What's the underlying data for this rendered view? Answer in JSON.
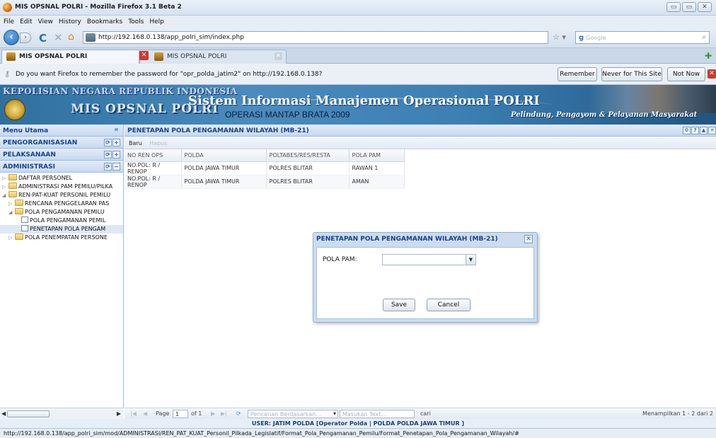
{
  "window": {
    "title": "MIS OPSNAL POLRI - Mozilla Firefox 3.1 Beta 2",
    "buttons": [
      "▭",
      "▭",
      "✕"
    ]
  },
  "menubar": [
    "File",
    "Edit",
    "View",
    "History",
    "Bookmarks",
    "Tools",
    "Help"
  ],
  "nav": {
    "url": "http://192.168.0.138/app_polri_sim/index.php",
    "search_placeholder": "Google"
  },
  "tabs": [
    {
      "label": "MIS OPSNAL POLRI",
      "active": true
    },
    {
      "label": "MIS OPSNAL POLRI",
      "active": false
    }
  ],
  "password_bar": {
    "message": "Do you want Firefox to remember the password for \"opr_polda_jatim2\" on http://192.168.0.138?",
    "remember": "Remember",
    "never": "Never for This Site",
    "not_now": "Not Now"
  },
  "banner": {
    "org": "KEPOLISIAN NEGARA REPUBLIK INDONESIA",
    "app": "MIS OPSNAL POLRI",
    "system": "Sistem Informasi Manajemen Operasional POLRI",
    "operation": "OPERASI MANTAP BRATA 2009",
    "motto": "Pelindung, Pengayom & Pelayanan Masyarakat"
  },
  "left": {
    "menu_title": "Menu Utama",
    "sections": [
      {
        "label": "PENGORGANISASIAN"
      },
      {
        "label": "PELAKSANAAN"
      },
      {
        "label": "ADMINISTRASI"
      }
    ],
    "tree": [
      {
        "label": "DAFTAR PERSONEL",
        "indent": 0,
        "open": false,
        "type": "folder"
      },
      {
        "label": "ADMINISTRASI PAM PEMILU/PILKA",
        "indent": 0,
        "open": false,
        "type": "folder"
      },
      {
        "label": "REN-PAT-KUAT PERSONIL PEMILU",
        "indent": 0,
        "open": true,
        "type": "folder"
      },
      {
        "label": "RENCANA PENGGELARAN PAS",
        "indent": 1,
        "open": false,
        "type": "folder"
      },
      {
        "label": "POLA PENGAMANAN PEMILU",
        "indent": 1,
        "open": true,
        "type": "folder"
      },
      {
        "label": "POLA PENGAMANAN PEMIL",
        "indent": 2,
        "type": "doc"
      },
      {
        "label": "PENETAPAN POLA PENGAM",
        "indent": 2,
        "type": "doc",
        "selected": true
      },
      {
        "label": "POLA PENEMPATAN PERSONE",
        "indent": 1,
        "open": false,
        "type": "folder"
      }
    ]
  },
  "main": {
    "title": "PENETAPAN POLA PENGAMANAN WILAYAH (MB-21)",
    "toolbar": {
      "new": "Baru",
      "delete": "Hapus"
    },
    "columns": [
      "NO REN OPS",
      "POLDA",
      "POLTABES/RES/RESTA",
      "POLA PAM"
    ],
    "rows": [
      [
        "NO.POL: R / RENOP",
        "POLDA JAWA TIMUR",
        "POLRES BLITAR",
        "RAWAN 1"
      ],
      [
        "NO.POL: R / RENOP",
        "POLDA JAWA TIMUR",
        "POLRES BLITAR",
        "AMAN"
      ]
    ],
    "pager": {
      "page_label": "Page",
      "page": "1",
      "of": "of 1",
      "search_by": "Pencarian Berdasarkan...",
      "search_text": "Masukan Text...",
      "search_btn": "cari",
      "display": "Menampilkan 1 - 2 dari 2"
    }
  },
  "dialog": {
    "title": "PENETAPAN POLA PENGAMANAN WILAYAH (MB-21)",
    "field_label": "POLA PAM:",
    "field_value": "",
    "save": "Save",
    "cancel": "Cancel"
  },
  "user_line": "USER: JATIM POLDA [Operator Polda | POLDA POLDA JAWA TIMUR ]",
  "status_url": "http://192.168.0.138/app_polri_sim/mod/ADMINISTRASI/REN_PAT_KUAT_Personil_Pilkada_Legislatif/Format_Pola_Pengamanan_Pemilu/Format_Penetapan_Pola_Pengamanan_Wilayah/#"
}
